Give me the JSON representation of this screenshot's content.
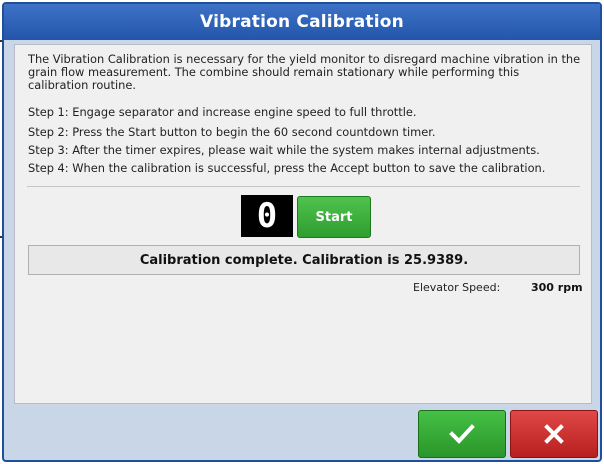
{
  "dialog": {
    "title": "Vibration Calibration",
    "description": "The Vibration Calibration is necessary for the yield monitor to disregard machine vibration in the grain flow measurement. The combine should remain stationary while performing this calibration routine.",
    "steps": [
      "Step 1: Engage separator and increase engine speed to full throttle.",
      "Step 2: Press the Start button to begin the 60 second countdown timer.",
      "Step 3: After the timer expires, please wait while the system makes internal adjustments.",
      "Step 4: When the calibration is successful, press the Accept button to save the calibration."
    ],
    "timer_value": "0",
    "start_label": "Start",
    "status_text": "Calibration complete.  Calibration is 25.9389.",
    "elevator_speed_label": "Elevator Speed:",
    "elevator_speed_value": "300 rpm",
    "accept_icon": "check-icon",
    "cancel_icon": "close-icon"
  },
  "colors": {
    "title_bar": "#2d63b8",
    "accept": "#33aa33",
    "cancel": "#cc3333",
    "start": "#3cb03c"
  }
}
